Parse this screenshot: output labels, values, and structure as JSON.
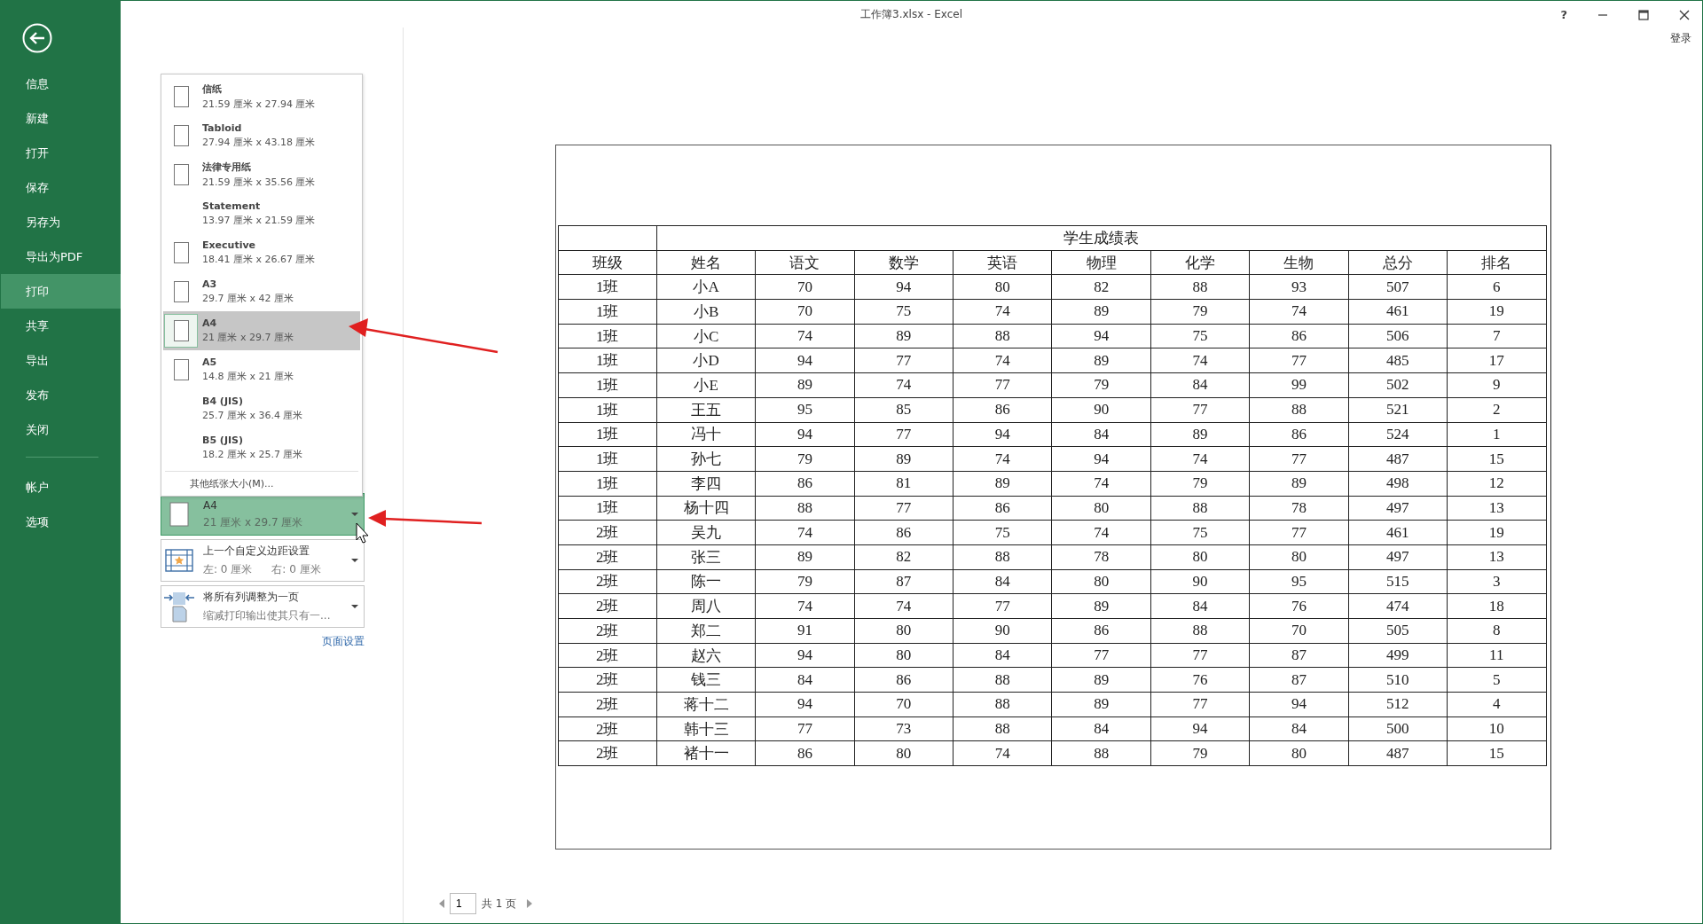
{
  "window": {
    "title": "工作簿3.xlsx - Excel",
    "help": "?",
    "sign_in": "登录"
  },
  "sidebar": {
    "items": [
      {
        "label": "信息",
        "selected": false
      },
      {
        "label": "新建",
        "selected": false
      },
      {
        "label": "打开",
        "selected": false
      },
      {
        "label": "保存",
        "selected": false
      },
      {
        "label": "另存为",
        "selected": false
      },
      {
        "label": "导出为PDF",
        "selected": false
      },
      {
        "label": "打印",
        "selected": true
      },
      {
        "label": "共享",
        "selected": false
      },
      {
        "label": "导出",
        "selected": false
      },
      {
        "label": "发布",
        "selected": false
      },
      {
        "label": "关闭",
        "selected": false
      }
    ],
    "footer_items": [
      {
        "label": "帐户",
        "selected": false
      },
      {
        "label": "选项",
        "selected": false
      }
    ]
  },
  "print_panel": {
    "paper_menu": {
      "items": [
        {
          "name": "信纸",
          "size": "21.59 厘米 x 27.94 厘米",
          "kind": "icon",
          "selected": false
        },
        {
          "name": "Tabloid",
          "size": "27.94 厘米 x 43.18 厘米",
          "kind": "icon",
          "selected": false
        },
        {
          "name": "法律专用纸",
          "size": "21.59 厘米 x 35.56 厘米",
          "kind": "icon",
          "selected": false
        },
        {
          "name": "Statement",
          "size": "13.97 厘米 x 21.59 厘米",
          "kind": "plain",
          "selected": false
        },
        {
          "name": "Executive",
          "size": "18.41 厘米 x 26.67 厘米",
          "kind": "icon",
          "selected": false
        },
        {
          "name": "A3",
          "size": "29.7 厘米 x 42 厘米",
          "kind": "icon",
          "selected": false
        },
        {
          "name": "A4",
          "size": "21 厘米 x 29.7 厘米",
          "kind": "icon",
          "selected": true
        },
        {
          "name": "A5",
          "size": "14.8 厘米 x 21 厘米",
          "kind": "icon",
          "selected": false
        },
        {
          "name": "B4 (JIS)",
          "size": "25.7 厘米 x 36.4 厘米",
          "kind": "plain",
          "selected": false
        },
        {
          "name": "B5 (JIS)",
          "size": "18.2 厘米 x 25.7 厘米",
          "kind": "plain",
          "selected": false
        }
      ],
      "more": "其他纸张大小(M)..."
    },
    "settings": [
      {
        "kind": "paper",
        "title": "A4",
        "details": [
          "21 厘米 x 29.7 厘米"
        ],
        "highlighted": true
      },
      {
        "kind": "margins",
        "title": "上一个自定义边距设置",
        "details": [
          "左: 0 厘米",
          "右: 0 厘米"
        ],
        "highlighted": false
      },
      {
        "kind": "scaling",
        "title": "将所有列调整为一页",
        "details": [
          "缩减打印输出使其只有一..."
        ],
        "highlighted": false
      }
    ],
    "page_setup_link": "页面设置"
  },
  "preview": {
    "table": {
      "title": "学生成绩表",
      "columns": [
        "班级",
        "姓名",
        "语文",
        "数学",
        "英语",
        "物理",
        "化学",
        "生物",
        "总分",
        "排名"
      ],
      "rows": [
        [
          "1班",
          "小A",
          "70",
          "94",
          "80",
          "82",
          "88",
          "93",
          "507",
          "6"
        ],
        [
          "1班",
          "小B",
          "70",
          "75",
          "74",
          "89",
          "79",
          "74",
          "461",
          "19"
        ],
        [
          "1班",
          "小C",
          "74",
          "89",
          "88",
          "94",
          "75",
          "86",
          "506",
          "7"
        ],
        [
          "1班",
          "小D",
          "94",
          "77",
          "74",
          "89",
          "74",
          "77",
          "485",
          "17"
        ],
        [
          "1班",
          "小E",
          "89",
          "74",
          "77",
          "79",
          "84",
          "99",
          "502",
          "9"
        ],
        [
          "1班",
          "王五",
          "95",
          "85",
          "86",
          "90",
          "77",
          "88",
          "521",
          "2"
        ],
        [
          "1班",
          "冯十",
          "94",
          "77",
          "94",
          "84",
          "89",
          "86",
          "524",
          "1"
        ],
        [
          "1班",
          "孙七",
          "79",
          "89",
          "74",
          "94",
          "74",
          "77",
          "487",
          "15"
        ],
        [
          "1班",
          "李四",
          "86",
          "81",
          "89",
          "74",
          "79",
          "89",
          "498",
          "12"
        ],
        [
          "1班",
          "杨十四",
          "88",
          "77",
          "86",
          "80",
          "88",
          "78",
          "497",
          "13"
        ],
        [
          "2班",
          "吴九",
          "74",
          "86",
          "75",
          "74",
          "75",
          "77",
          "461",
          "19"
        ],
        [
          "2班",
          "张三",
          "89",
          "82",
          "88",
          "78",
          "80",
          "80",
          "497",
          "13"
        ],
        [
          "2班",
          "陈一",
          "79",
          "87",
          "84",
          "80",
          "90",
          "95",
          "515",
          "3"
        ],
        [
          "2班",
          "周八",
          "74",
          "74",
          "77",
          "89",
          "84",
          "76",
          "474",
          "18"
        ],
        [
          "2班",
          "郑二",
          "91",
          "80",
          "90",
          "86",
          "88",
          "70",
          "505",
          "8"
        ],
        [
          "2班",
          "赵六",
          "94",
          "80",
          "84",
          "77",
          "77",
          "87",
          "499",
          "11"
        ],
        [
          "2班",
          "钱三",
          "84",
          "86",
          "88",
          "89",
          "76",
          "87",
          "510",
          "5"
        ],
        [
          "2班",
          "蒋十二",
          "94",
          "70",
          "88",
          "89",
          "77",
          "94",
          "512",
          "4"
        ],
        [
          "2班",
          "韩十三",
          "77",
          "73",
          "88",
          "84",
          "94",
          "84",
          "500",
          "10"
        ],
        [
          "2班",
          "褚十一",
          "86",
          "80",
          "74",
          "88",
          "79",
          "80",
          "487",
          "15"
        ]
      ]
    },
    "page_nav": {
      "page": "1",
      "total": "共 1 页"
    }
  }
}
